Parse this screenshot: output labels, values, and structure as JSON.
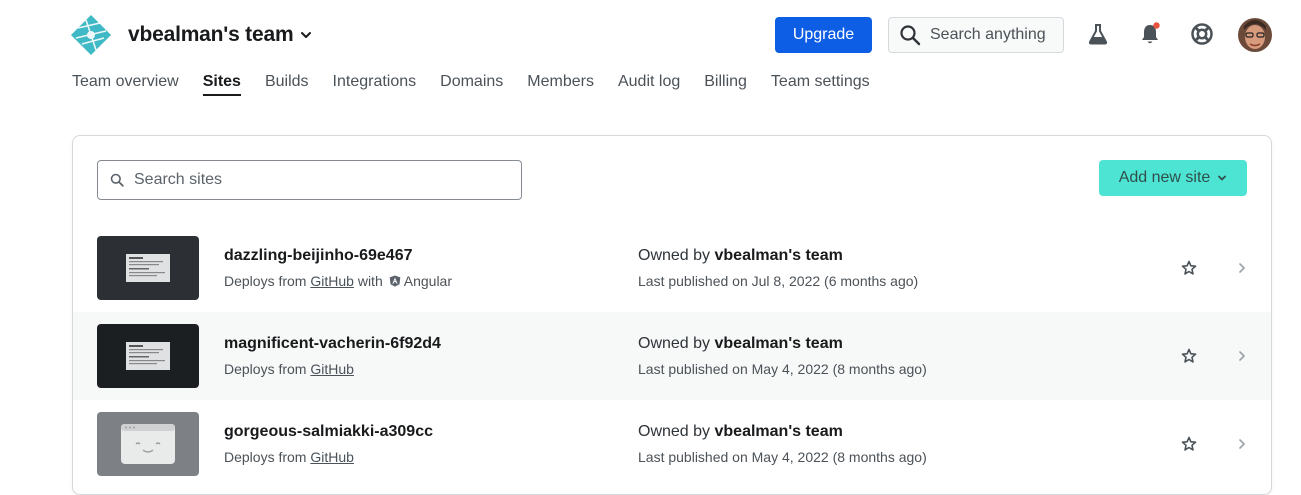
{
  "header": {
    "team_name": "vbealman's team",
    "upgrade_label": "Upgrade",
    "search_label": "Search anything",
    "icons": [
      "netlify-logo-icon",
      "chevron-down-icon",
      "search-icon",
      "flask-icon",
      "bell-icon",
      "lifebuoy-icon"
    ],
    "notification_dot_color": "#e8533d",
    "accent_color": "#0e5ee5"
  },
  "nav": {
    "items": [
      {
        "label": "Team overview",
        "active": false
      },
      {
        "label": "Sites",
        "active": true
      },
      {
        "label": "Builds",
        "active": false
      },
      {
        "label": "Integrations",
        "active": false
      },
      {
        "label": "Domains",
        "active": false
      },
      {
        "label": "Members",
        "active": false
      },
      {
        "label": "Audit log",
        "active": false
      },
      {
        "label": "Billing",
        "active": false
      },
      {
        "label": "Team settings",
        "active": false
      }
    ]
  },
  "sites_panel": {
    "search_placeholder": "Search sites",
    "add_site_label": "Add new site",
    "add_site_color": "#30e0cd",
    "sites": [
      {
        "name": "dazzling-beijinho-69e467",
        "deploys_prefix": "Deploys from",
        "deploys_source": "GitHub",
        "framework_prefix": "with",
        "framework": "Angular",
        "owner_prefix": "Owned by",
        "owner": "vbealman's team",
        "published": "Last published on Jul 8, 2022 (6 months ago)"
      },
      {
        "name": "magnificent-vacherin-6f92d4",
        "deploys_prefix": "Deploys from",
        "deploys_source": "GitHub",
        "owner_prefix": "Owned by",
        "owner": "vbealman's team",
        "published": "Last published on May 4, 2022 (8 months ago)"
      },
      {
        "name": "gorgeous-salmiakki-a309cc",
        "deploys_prefix": "Deploys from",
        "deploys_source": "GitHub",
        "owner_prefix": "Owned by",
        "owner": "vbealman's team",
        "published": "Last published on May 4, 2022 (8 months ago)"
      }
    ]
  }
}
